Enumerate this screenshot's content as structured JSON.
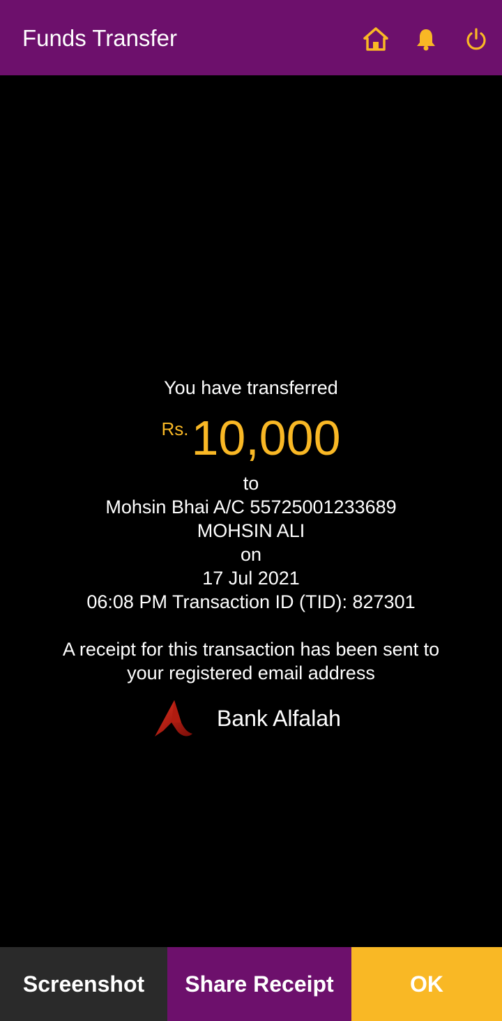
{
  "header": {
    "title": "Funds Transfer",
    "icons": [
      "home-icon",
      "bell-icon",
      "power-icon"
    ],
    "icon_color": "#f9b825",
    "bar_color": "#6d106c"
  },
  "receipt": {
    "intro": "You have transferred",
    "currency": "Rs.",
    "amount": "10,000",
    "to_label": "to",
    "recipient": "Mohsin Bhai A/C 55725001233689",
    "recipient_name": "MOHSIN ALI",
    "on_label": "on",
    "date": "17 Jul 2021",
    "time_tid": "06:08 PM Transaction ID (TID): 827301",
    "email_note_line1": "A receipt for this transaction has been sent to",
    "email_note_line2": "your registered email address",
    "bank_name": "Bank Alfalah",
    "amount_color": "#f9b825"
  },
  "actions": {
    "screenshot": "Screenshot",
    "share_receipt": "Share Receipt",
    "ok": "OK"
  }
}
